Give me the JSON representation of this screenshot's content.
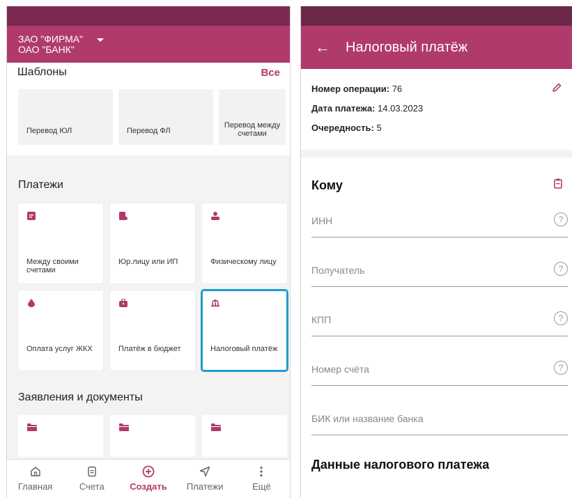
{
  "left": {
    "org": {
      "line1": "ЗАО \"ФИРМА\"",
      "line2": "ОАО \"БАНК\""
    },
    "templates": {
      "title": "Шаблоны",
      "all_label": "Все",
      "items": [
        "Перевод ЮЛ",
        "Перевод ФЛ",
        "Перевод между счетами"
      ]
    },
    "payments": {
      "title": "Платежи",
      "tiles": [
        {
          "label": "Между своими счетами",
          "icon": "document-icon"
        },
        {
          "label": "Юр.лицу или ИП",
          "icon": "building-icon"
        },
        {
          "label": "Физическому лицу",
          "icon": "person-icon"
        },
        {
          "label": "Оплата услуг ЖКХ",
          "icon": "drop-icon"
        },
        {
          "label": "Платёж в бюджет",
          "icon": "briefcase-icon"
        },
        {
          "label": "Налоговый платёж",
          "icon": "bank-icon",
          "selected": true
        }
      ]
    },
    "docs": {
      "title": "Заявления и документы"
    },
    "nav": [
      {
        "label": "Главная",
        "icon": "home-icon"
      },
      {
        "label": "Счета",
        "icon": "accounts-icon"
      },
      {
        "label": "Создать",
        "icon": "plus-circle-icon",
        "active": true
      },
      {
        "label": "Платежи",
        "icon": "send-icon"
      },
      {
        "label": "Ещё",
        "icon": "more-icon"
      }
    ]
  },
  "right": {
    "title": "Налоговый платёж",
    "info": {
      "op_label": "Номер операции:",
      "op_value": "76",
      "date_label": "Дата платежа:",
      "date_value": "14.03.2023",
      "order_label": "Очередность:",
      "order_value": "5"
    },
    "to_title": "Кому",
    "fields": {
      "inn": "ИНН",
      "recipient": "Получатель",
      "kpp": "КПП",
      "account": "Номер счёта",
      "bik": "БИК или название банка"
    },
    "help_glyph": "?",
    "tax_title": "Данные налогового платежа"
  },
  "colors": {
    "brand": "#b03a6c",
    "statusbar": "#7a2a50",
    "selection": "#1e9dd1"
  }
}
